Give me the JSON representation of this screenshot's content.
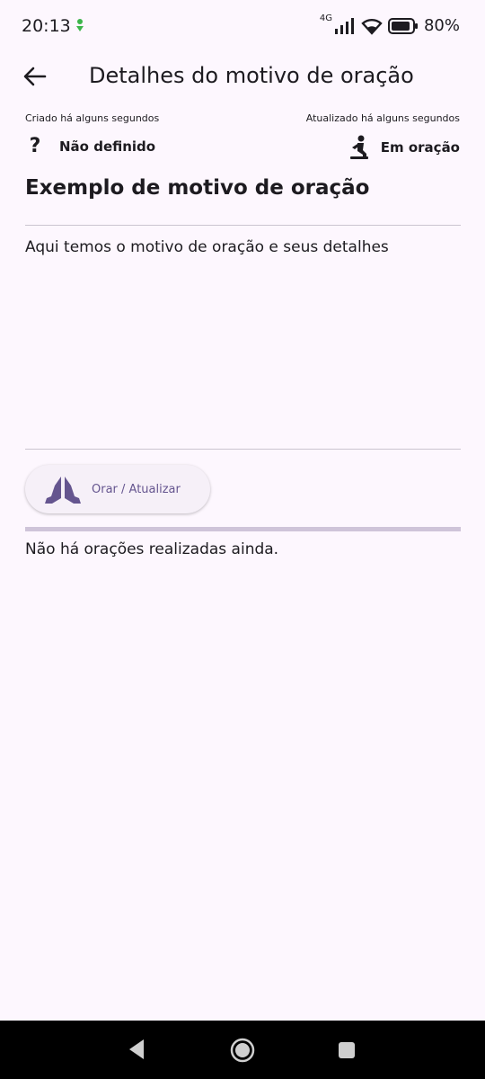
{
  "status_bar": {
    "time": "20:13",
    "network": "4G",
    "battery": "80%"
  },
  "app_bar": {
    "title": "Detalhes do motivo de oração",
    "back_icon": "arrow-left-icon"
  },
  "meta": {
    "created": "Criado há alguns segundos",
    "updated": "Atualizado há alguns segundos"
  },
  "status": {
    "category_icon": "question-mark-icon",
    "category_label": "Não definido",
    "state_icon": "praying-person-icon",
    "state_label": "Em oração"
  },
  "item": {
    "title": "Exemplo de motivo de oração",
    "description": "Aqui temos o motivo de oração e seus detalhes"
  },
  "pray_button": {
    "icon": "praying-hands-icon",
    "label": "Orar / Atualizar"
  },
  "prayers": {
    "empty_message": "Não há orações realizadas ainda."
  },
  "colors": {
    "background": "#fdf7fe",
    "accent": "#65558f",
    "text": "#1d1b20",
    "divider": "#cac4d0"
  }
}
